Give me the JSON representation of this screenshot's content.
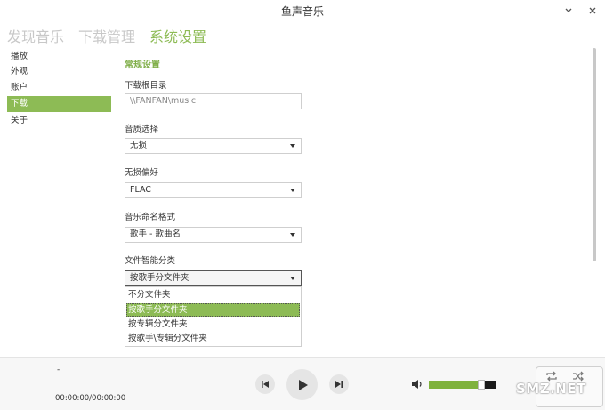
{
  "window": {
    "title": "鱼声音乐",
    "minimize_icon": "minimize-icon",
    "close_icon": "close-icon"
  },
  "topnav": {
    "tabs": [
      {
        "label": "发现音乐",
        "active": false
      },
      {
        "label": "下载管理",
        "active": false
      },
      {
        "label": "系统设置",
        "active": true
      }
    ]
  },
  "sidebar": {
    "items": [
      {
        "label": "播放",
        "active": false
      },
      {
        "label": "外观",
        "active": false
      },
      {
        "label": "账户",
        "active": false
      },
      {
        "label": "下载",
        "active": true
      },
      {
        "label": "关于",
        "active": false
      }
    ]
  },
  "settings": {
    "section_title": "常规设置",
    "download_root_label": "下载根目录",
    "download_root_value": "\\\\FANFAN\\music",
    "quality_label": "音质选择",
    "quality_value": "无损",
    "lossless_pref_label": "无损偏好",
    "lossless_pref_value": "FLAC",
    "naming_label": "音乐命名格式",
    "naming_value": "歌手 - 歌曲名",
    "classify_label": "文件智能分类",
    "classify_value": "按歌手分文件夹",
    "classify_options": [
      {
        "label": "不分文件夹",
        "selected": false
      },
      {
        "label": "按歌手分文件夹",
        "selected": true
      },
      {
        "label": "按专辑分文件夹",
        "selected": false
      },
      {
        "label": "按歌手\\专辑分文件夹",
        "selected": false
      }
    ]
  },
  "player": {
    "song_title": "-",
    "time": "00:00:00/00:00:00",
    "volume_percent": 78,
    "icons": {
      "prev": "skip-previous-icon",
      "play": "play-icon",
      "next": "skip-next-icon",
      "volume": "volume-icon",
      "repeat": "repeat-icon",
      "shuffle": "shuffle-icon"
    },
    "colors": {
      "accent": "#8dbb55",
      "volume_fill": "#7fb23d"
    }
  },
  "watermark": {
    "text": "SMZ.NET"
  }
}
